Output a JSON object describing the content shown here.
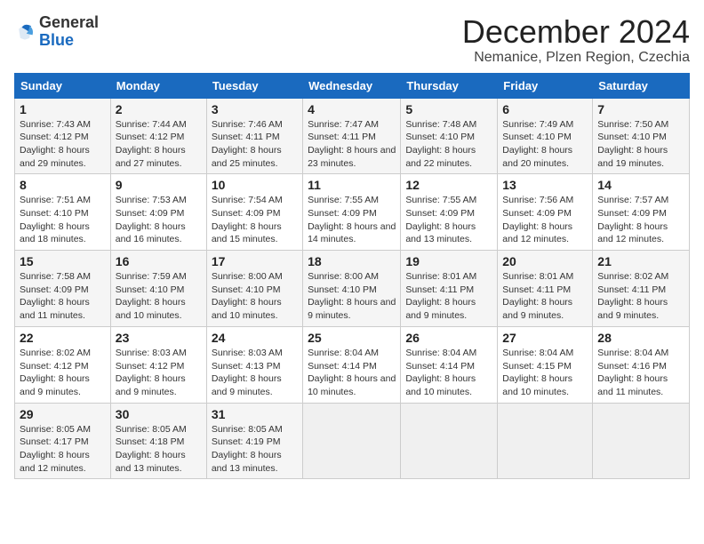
{
  "logo": {
    "general": "General",
    "blue": "Blue"
  },
  "title": "December 2024",
  "location": "Nemanice, Plzen Region, Czechia",
  "weekdays": [
    "Sunday",
    "Monday",
    "Tuesday",
    "Wednesday",
    "Thursday",
    "Friday",
    "Saturday"
  ],
  "weeks": [
    [
      {
        "day": "1",
        "sunrise": "7:43 AM",
        "sunset": "4:12 PM",
        "daylight": "8 hours and 29 minutes."
      },
      {
        "day": "2",
        "sunrise": "7:44 AM",
        "sunset": "4:12 PM",
        "daylight": "8 hours and 27 minutes."
      },
      {
        "day": "3",
        "sunrise": "7:46 AM",
        "sunset": "4:11 PM",
        "daylight": "8 hours and 25 minutes."
      },
      {
        "day": "4",
        "sunrise": "7:47 AM",
        "sunset": "4:11 PM",
        "daylight": "8 hours and 23 minutes."
      },
      {
        "day": "5",
        "sunrise": "7:48 AM",
        "sunset": "4:10 PM",
        "daylight": "8 hours and 22 minutes."
      },
      {
        "day": "6",
        "sunrise": "7:49 AM",
        "sunset": "4:10 PM",
        "daylight": "8 hours and 20 minutes."
      },
      {
        "day": "7",
        "sunrise": "7:50 AM",
        "sunset": "4:10 PM",
        "daylight": "8 hours and 19 minutes."
      }
    ],
    [
      {
        "day": "8",
        "sunrise": "7:51 AM",
        "sunset": "4:10 PM",
        "daylight": "8 hours and 18 minutes."
      },
      {
        "day": "9",
        "sunrise": "7:53 AM",
        "sunset": "4:09 PM",
        "daylight": "8 hours and 16 minutes."
      },
      {
        "day": "10",
        "sunrise": "7:54 AM",
        "sunset": "4:09 PM",
        "daylight": "8 hours and 15 minutes."
      },
      {
        "day": "11",
        "sunrise": "7:55 AM",
        "sunset": "4:09 PM",
        "daylight": "8 hours and 14 minutes."
      },
      {
        "day": "12",
        "sunrise": "7:55 AM",
        "sunset": "4:09 PM",
        "daylight": "8 hours and 13 minutes."
      },
      {
        "day": "13",
        "sunrise": "7:56 AM",
        "sunset": "4:09 PM",
        "daylight": "8 hours and 12 minutes."
      },
      {
        "day": "14",
        "sunrise": "7:57 AM",
        "sunset": "4:09 PM",
        "daylight": "8 hours and 12 minutes."
      }
    ],
    [
      {
        "day": "15",
        "sunrise": "7:58 AM",
        "sunset": "4:09 PM",
        "daylight": "8 hours and 11 minutes."
      },
      {
        "day": "16",
        "sunrise": "7:59 AM",
        "sunset": "4:10 PM",
        "daylight": "8 hours and 10 minutes."
      },
      {
        "day": "17",
        "sunrise": "8:00 AM",
        "sunset": "4:10 PM",
        "daylight": "8 hours and 10 minutes."
      },
      {
        "day": "18",
        "sunrise": "8:00 AM",
        "sunset": "4:10 PM",
        "daylight": "8 hours and 9 minutes."
      },
      {
        "day": "19",
        "sunrise": "8:01 AM",
        "sunset": "4:11 PM",
        "daylight": "8 hours and 9 minutes."
      },
      {
        "day": "20",
        "sunrise": "8:01 AM",
        "sunset": "4:11 PM",
        "daylight": "8 hours and 9 minutes."
      },
      {
        "day": "21",
        "sunrise": "8:02 AM",
        "sunset": "4:11 PM",
        "daylight": "8 hours and 9 minutes."
      }
    ],
    [
      {
        "day": "22",
        "sunrise": "8:02 AM",
        "sunset": "4:12 PM",
        "daylight": "8 hours and 9 minutes."
      },
      {
        "day": "23",
        "sunrise": "8:03 AM",
        "sunset": "4:12 PM",
        "daylight": "8 hours and 9 minutes."
      },
      {
        "day": "24",
        "sunrise": "8:03 AM",
        "sunset": "4:13 PM",
        "daylight": "8 hours and 9 minutes."
      },
      {
        "day": "25",
        "sunrise": "8:04 AM",
        "sunset": "4:14 PM",
        "daylight": "8 hours and 10 minutes."
      },
      {
        "day": "26",
        "sunrise": "8:04 AM",
        "sunset": "4:14 PM",
        "daylight": "8 hours and 10 minutes."
      },
      {
        "day": "27",
        "sunrise": "8:04 AM",
        "sunset": "4:15 PM",
        "daylight": "8 hours and 10 minutes."
      },
      {
        "day": "28",
        "sunrise": "8:04 AM",
        "sunset": "4:16 PM",
        "daylight": "8 hours and 11 minutes."
      }
    ],
    [
      {
        "day": "29",
        "sunrise": "8:05 AM",
        "sunset": "4:17 PM",
        "daylight": "8 hours and 12 minutes."
      },
      {
        "day": "30",
        "sunrise": "8:05 AM",
        "sunset": "4:18 PM",
        "daylight": "8 hours and 13 minutes."
      },
      {
        "day": "31",
        "sunrise": "8:05 AM",
        "sunset": "4:19 PM",
        "daylight": "8 hours and 13 minutes."
      },
      null,
      null,
      null,
      null
    ]
  ]
}
